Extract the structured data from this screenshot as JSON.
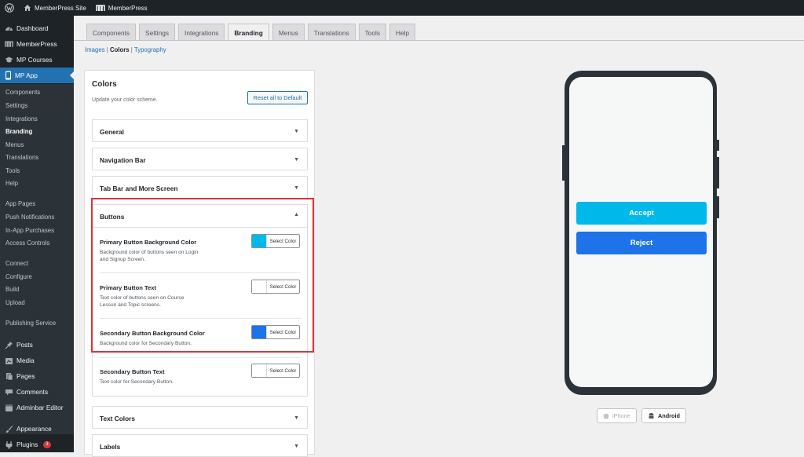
{
  "adminbar": {
    "site_name": "MemberPress Site",
    "plugin_name": "MemberPress"
  },
  "sidebar": {
    "top_items": [
      {
        "label": "Dashboard",
        "icon": "dashboard-icon"
      },
      {
        "label": "MemberPress",
        "icon": "memberpress-icon"
      },
      {
        "label": "MP Courses",
        "icon": "graduation-cap-icon"
      },
      {
        "label": "MP App",
        "icon": "mobile-icon"
      }
    ],
    "app_submenu": [
      "Components",
      "Settings",
      "Integrations",
      "Branding",
      "Menus",
      "Translations",
      "Tools",
      "Help",
      "App Pages",
      "Push Notifications",
      "In-App Purchases",
      "Access Controls",
      "Connect",
      "Configure",
      "Build",
      "Upload",
      "Publishing Service"
    ],
    "current_submenu": "Branding",
    "bottom_items": [
      {
        "label": "Posts",
        "icon": "pin-icon"
      },
      {
        "label": "Media",
        "icon": "media-icon"
      },
      {
        "label": "Pages",
        "icon": "pages-icon"
      },
      {
        "label": "Comments",
        "icon": "comment-icon"
      },
      {
        "label": "Adminbar Editor",
        "icon": "adminbar-editor-icon"
      },
      {
        "label": "Appearance",
        "icon": "brush-icon"
      },
      {
        "label": "Plugins",
        "icon": "plugin-icon",
        "badge": "3"
      }
    ]
  },
  "tabs": [
    "Components",
    "Settings",
    "Integrations",
    "Branding",
    "Menus",
    "Translations",
    "Tools",
    "Help"
  ],
  "active_tab": "Branding",
  "subnav": {
    "images": "Images",
    "sep1": " | ",
    "colors": "Colors",
    "sep2": " | ",
    "typography": "Typography"
  },
  "panel": {
    "title": "Colors",
    "description": "Update your color scheme.",
    "reset_label": "Reset all to Default",
    "sections_top": [
      "General",
      "Navigation Bar",
      "Tab Bar and More Screen"
    ],
    "buttons_section": {
      "label": "Buttons",
      "items": [
        {
          "title": "Primary Button Background Color",
          "desc": "Background color of buttons seen on Login and Signup Screen.",
          "swatch": "#00b9eb",
          "select": "Select Color"
        },
        {
          "title": "Primary Button Text",
          "desc": "Text color of buttons seen on Course Lesson and Topic screens.",
          "swatch": "#ffffff",
          "select": "Select Color"
        },
        {
          "title": "Secondary Button Background Color",
          "desc": "Background color for Secondary Button.",
          "swatch": "#1e73e8",
          "select": "Select Color"
        },
        {
          "title": "Secondary Button Text",
          "desc": "Text color for Secondary Button.",
          "swatch": "#ffffff",
          "select": "Select Color"
        }
      ]
    },
    "sections_bottom": [
      "Text Colors",
      "Labels"
    ]
  },
  "preview": {
    "accept_label": "Accept",
    "reject_label": "Reject",
    "accept_color": "#00b9eb",
    "reject_color": "#1e73e8",
    "devices": [
      "iPhone",
      "Android"
    ]
  },
  "colors": {
    "accent": "#2271b1",
    "highlight": "#d63638",
    "sidebar": "#1d2327"
  }
}
